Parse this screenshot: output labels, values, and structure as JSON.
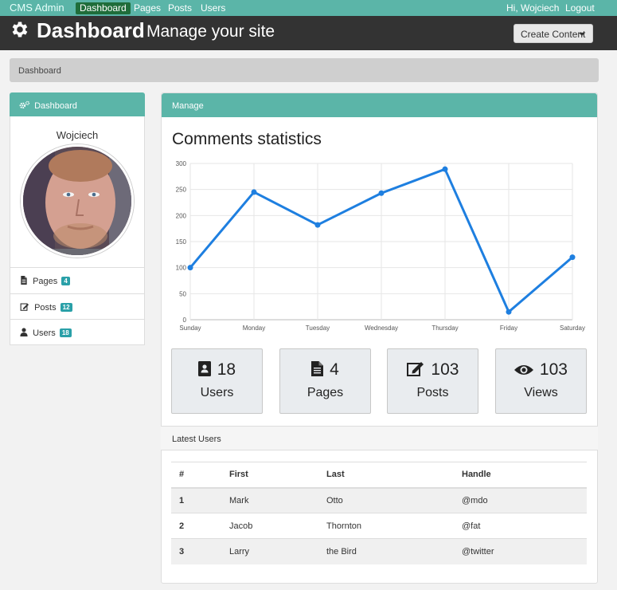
{
  "topnav": {
    "brand": "CMS Admin",
    "items": [
      "Dashboard",
      "Pages",
      "Posts",
      "Users"
    ],
    "greeting": "Hi, Wojciech",
    "logout": "Logout"
  },
  "header": {
    "title": "Dashboard",
    "subtitle": "Manage your site",
    "create_button": "Create Content"
  },
  "breadcrumb": "Dashboard",
  "sidebar": {
    "heading": "Dashboard",
    "user_name": "Wojciech",
    "items": [
      {
        "label": "Pages",
        "badge": "4",
        "icon": "file-icon"
      },
      {
        "label": "Posts",
        "badge": "12",
        "icon": "edit-icon"
      },
      {
        "label": "Users",
        "badge": "18",
        "icon": "user-icon"
      }
    ]
  },
  "main": {
    "heading": "Manage",
    "chart_title": "Comments statistics"
  },
  "chart_data": {
    "type": "line",
    "title": "Comments statistics",
    "categories": [
      "Sunday",
      "Monday",
      "Tuesday",
      "Wednesday",
      "Thursday",
      "Friday",
      "Saturday"
    ],
    "series": [
      {
        "values": [
          100,
          245,
          182,
          243,
          289,
          15,
          120
        ]
      }
    ],
    "ylim": [
      0,
      300
    ],
    "yticks": [
      0,
      50,
      100,
      150,
      200,
      250,
      300
    ],
    "grid": true,
    "color": "#1e7fe0"
  },
  "stats": [
    {
      "value": "18",
      "label": "Users",
      "icon": "contact-card-icon"
    },
    {
      "value": "4",
      "label": "Pages",
      "icon": "file-icon"
    },
    {
      "value": "103",
      "label": "Posts",
      "icon": "edit-icon"
    },
    {
      "value": "103",
      "label": "Views",
      "icon": "eye-icon"
    }
  ],
  "latest_users": {
    "heading": "Latest Users",
    "columns": [
      "#",
      "First",
      "Last",
      "Handle"
    ],
    "rows": [
      [
        "1",
        "Mark",
        "Otto",
        "@mdo"
      ],
      [
        "2",
        "Jacob",
        "Thornton",
        "@fat"
      ],
      [
        "3",
        "Larry",
        "the Bird",
        "@twitter"
      ]
    ]
  },
  "colors": {
    "accent": "#5bb5a8",
    "header_bg": "#333333",
    "active_nav": "#1f6d3a",
    "badge": "#2aa0a8"
  }
}
